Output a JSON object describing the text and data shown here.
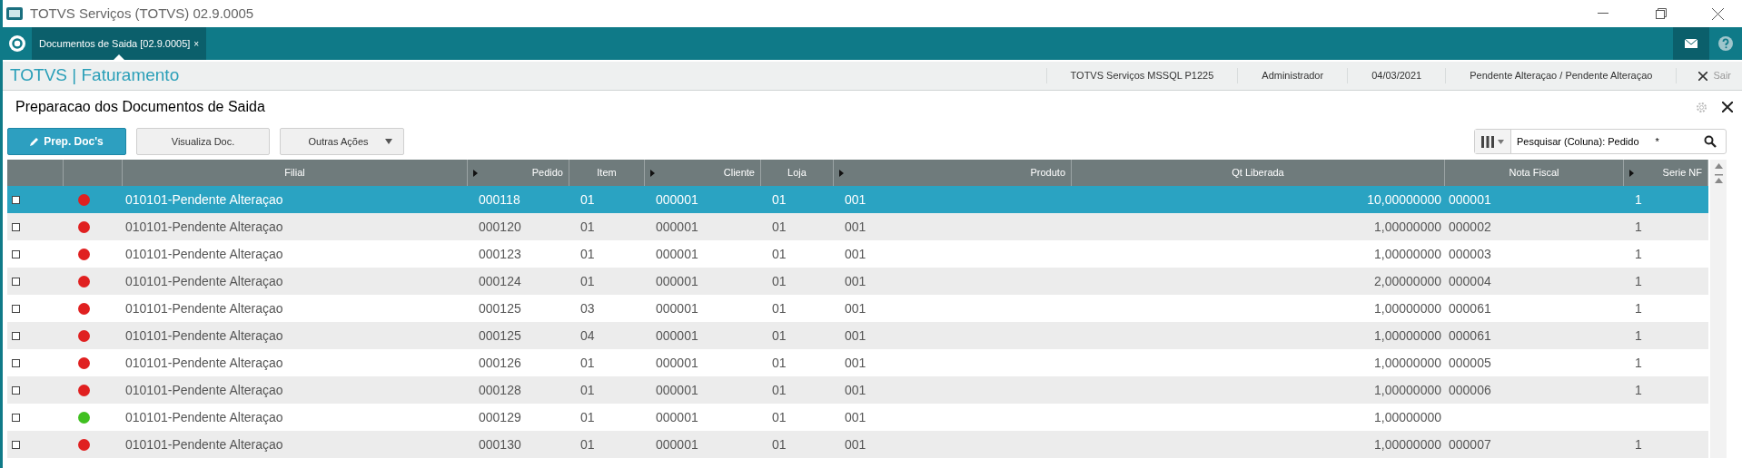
{
  "window": {
    "title": "TOTVS Serviços (TOTVS) 02.9.0005"
  },
  "tabs": [
    {
      "label": "Documentos de Saida [02.9.0005]",
      "close": "×",
      "selected": true
    }
  ],
  "module_bar": {
    "title": "TOTVS | Faturamento",
    "items": [
      "TOTVS Serviços MSSQL P1225",
      "Administrador",
      "04/03/2021",
      "Pendente Alteraçao / Pendente Alteraçao"
    ],
    "exit": "Sair"
  },
  "page": {
    "title": "Preparacao dos Documentos de Saida"
  },
  "toolbar": {
    "buttons": [
      {
        "label": "Prep. Doc's",
        "kind": "primary"
      },
      {
        "label": "Visualiza Doc.",
        "kind": "plain"
      },
      {
        "label": "Outras Ações",
        "kind": "menu"
      }
    ],
    "search": {
      "label": "Pesquisar (Coluna): Pedido",
      "value": "*"
    }
  },
  "table": {
    "columns": [
      {
        "sortable": false
      },
      {
        "sortable": false
      },
      {
        "label": "Filial",
        "sortable": false
      },
      {
        "label": "Pedido",
        "sortable": true
      },
      {
        "label": "Item",
        "sortable": false
      },
      {
        "label": "Cliente",
        "sortable": true
      },
      {
        "label": "Loja",
        "sortable": false
      },
      {
        "label": "Produto",
        "sortable": true
      },
      {
        "label": "Qt Liberada",
        "sortable": false
      },
      {
        "label": "Nota Fiscal",
        "sortable": false
      },
      {
        "label": "Serie NF",
        "sortable": true
      }
    ],
    "rows": [
      {
        "selected": true,
        "checked": false,
        "color": "#e02020",
        "cells": [
          "010101-Pendente Alteraçao",
          "000118",
          "01",
          "000001",
          "01",
          "001",
          "10,00000000",
          "000001",
          "1"
        ]
      },
      {
        "selected": false,
        "checked": false,
        "color": "#e02020",
        "cells": [
          "010101-Pendente Alteraçao",
          "000120",
          "01",
          "000001",
          "01",
          "001",
          "1,00000000",
          "000002",
          "1"
        ]
      },
      {
        "selected": false,
        "checked": false,
        "color": "#e02020",
        "cells": [
          "010101-Pendente Alteraçao",
          "000123",
          "01",
          "000001",
          "01",
          "001",
          "1,00000000",
          "000003",
          "1"
        ]
      },
      {
        "selected": false,
        "checked": false,
        "color": "#e02020",
        "cells": [
          "010101-Pendente Alteraçao",
          "000124",
          "01",
          "000001",
          "01",
          "001",
          "2,00000000",
          "000004",
          "1"
        ]
      },
      {
        "selected": false,
        "checked": false,
        "color": "#e02020",
        "cells": [
          "010101-Pendente Alteraçao",
          "000125",
          "03",
          "000001",
          "01",
          "001",
          "1,00000000",
          "000061",
          "1"
        ]
      },
      {
        "selected": false,
        "checked": false,
        "color": "#e02020",
        "cells": [
          "010101-Pendente Alteraçao",
          "000125",
          "04",
          "000001",
          "01",
          "001",
          "1,00000000",
          "000061",
          "1"
        ]
      },
      {
        "selected": false,
        "checked": false,
        "color": "#e02020",
        "cells": [
          "010101-Pendente Alteraçao",
          "000126",
          "01",
          "000001",
          "01",
          "001",
          "1,00000000",
          "000005",
          "1"
        ]
      },
      {
        "selected": false,
        "checked": false,
        "color": "#e02020",
        "cells": [
          "010101-Pendente Alteraçao",
          "000128",
          "01",
          "000001",
          "01",
          "001",
          "1,00000000",
          "000006",
          "1"
        ]
      },
      {
        "selected": false,
        "checked": false,
        "color": "#40c020",
        "cells": [
          "010101-Pendente Alteraçao",
          "000129",
          "01",
          "000001",
          "01",
          "001",
          "1,00000000",
          null,
          null
        ]
      },
      {
        "selected": false,
        "checked": false,
        "color": "#e02020",
        "cells": [
          "010101-Pendente Alteraçao",
          "000130",
          "01",
          "000001",
          "01",
          "001",
          "1,00000000",
          "000007",
          "1"
        ]
      }
    ]
  }
}
